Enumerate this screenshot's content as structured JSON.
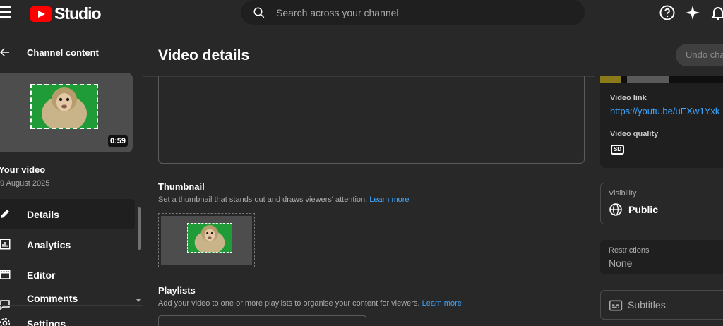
{
  "app": {
    "logo_text": "Studio"
  },
  "search": {
    "placeholder": "Search across your channel"
  },
  "sidebar": {
    "header": "Channel content",
    "video": {
      "title": "Your video",
      "date": "9 August 2025",
      "duration": "0:59"
    },
    "items": [
      {
        "label": "Details",
        "icon": "pencil-icon",
        "active": true
      },
      {
        "label": "Analytics",
        "icon": "analytics-icon",
        "active": false
      },
      {
        "label": "Editor",
        "icon": "editor-icon",
        "active": false
      },
      {
        "label": "Comments",
        "icon": "comments-icon",
        "active": false
      }
    ],
    "settings_label": "Settings"
  },
  "main": {
    "title": "Video details",
    "undo_label": "Undo changes",
    "thumbnail": {
      "title": "Thumbnail",
      "desc": "Set a thumbnail that stands out and draws viewers' attention.",
      "learn_more": "Learn more"
    },
    "playlists": {
      "title": "Playlists",
      "desc": "Add your video to one or more playlists to organise your content for viewers.",
      "learn_more": "Learn more"
    }
  },
  "right": {
    "video_link_label": "Video link",
    "video_link": "https://youtu.be/uEXw1Yxk",
    "video_quality_label": "Video quality",
    "quality_badge": "SD",
    "visibility_label": "Visibility",
    "visibility_value": "Public",
    "restrictions_label": "Restrictions",
    "restrictions_value": "None",
    "subtitles_label": "Subtitles"
  },
  "colors": {
    "accent_link": "#3ea6ff",
    "brand_red": "#ff0000",
    "background": "#282828"
  }
}
